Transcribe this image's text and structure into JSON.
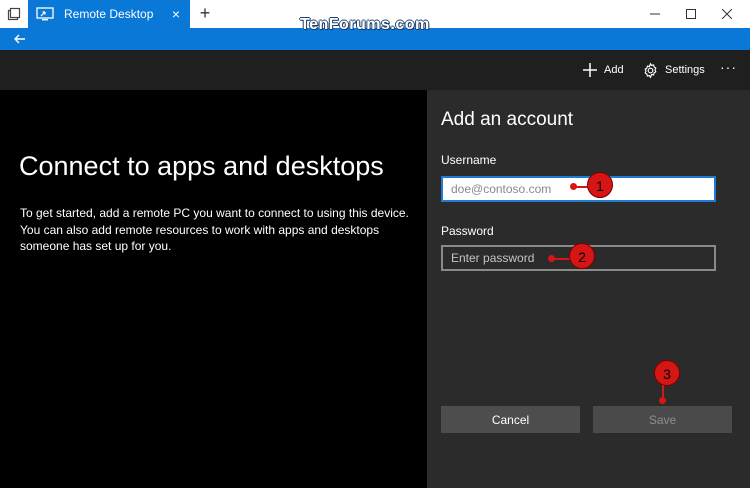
{
  "titlebar": {
    "tab_label": "Remote Desktop",
    "close_tab": "×",
    "new_tab": "+"
  },
  "watermark": "TenForums.com",
  "commandbar": {
    "add_label": "Add",
    "settings_label": "Settings",
    "more_label": "···"
  },
  "left": {
    "title": "Connect to apps and desktops",
    "description": "To get started, add a remote PC you want to connect to using this device. You can also add remote resources to work with apps and desktops someone has set up for you."
  },
  "form": {
    "title": "Add an account",
    "username_label": "Username",
    "username_placeholder": "doe@contoso.com",
    "username_value": "",
    "password_label": "Password",
    "password_placeholder": "Enter password",
    "password_value": "",
    "cancel_label": "Cancel",
    "save_label": "Save"
  },
  "markers": [
    "1",
    "2",
    "3"
  ],
  "colors": {
    "accent": "#0a78d7",
    "marker": "#d61515",
    "pane_dark": "#000000",
    "pane_form": "#2b2b2b"
  },
  "icons": [
    "window-icon",
    "remote-desktop-icon",
    "close-icon",
    "plus-icon",
    "minimize-icon",
    "maximize-icon",
    "back-arrow-icon",
    "add-icon",
    "gear-icon",
    "more-icon"
  ]
}
